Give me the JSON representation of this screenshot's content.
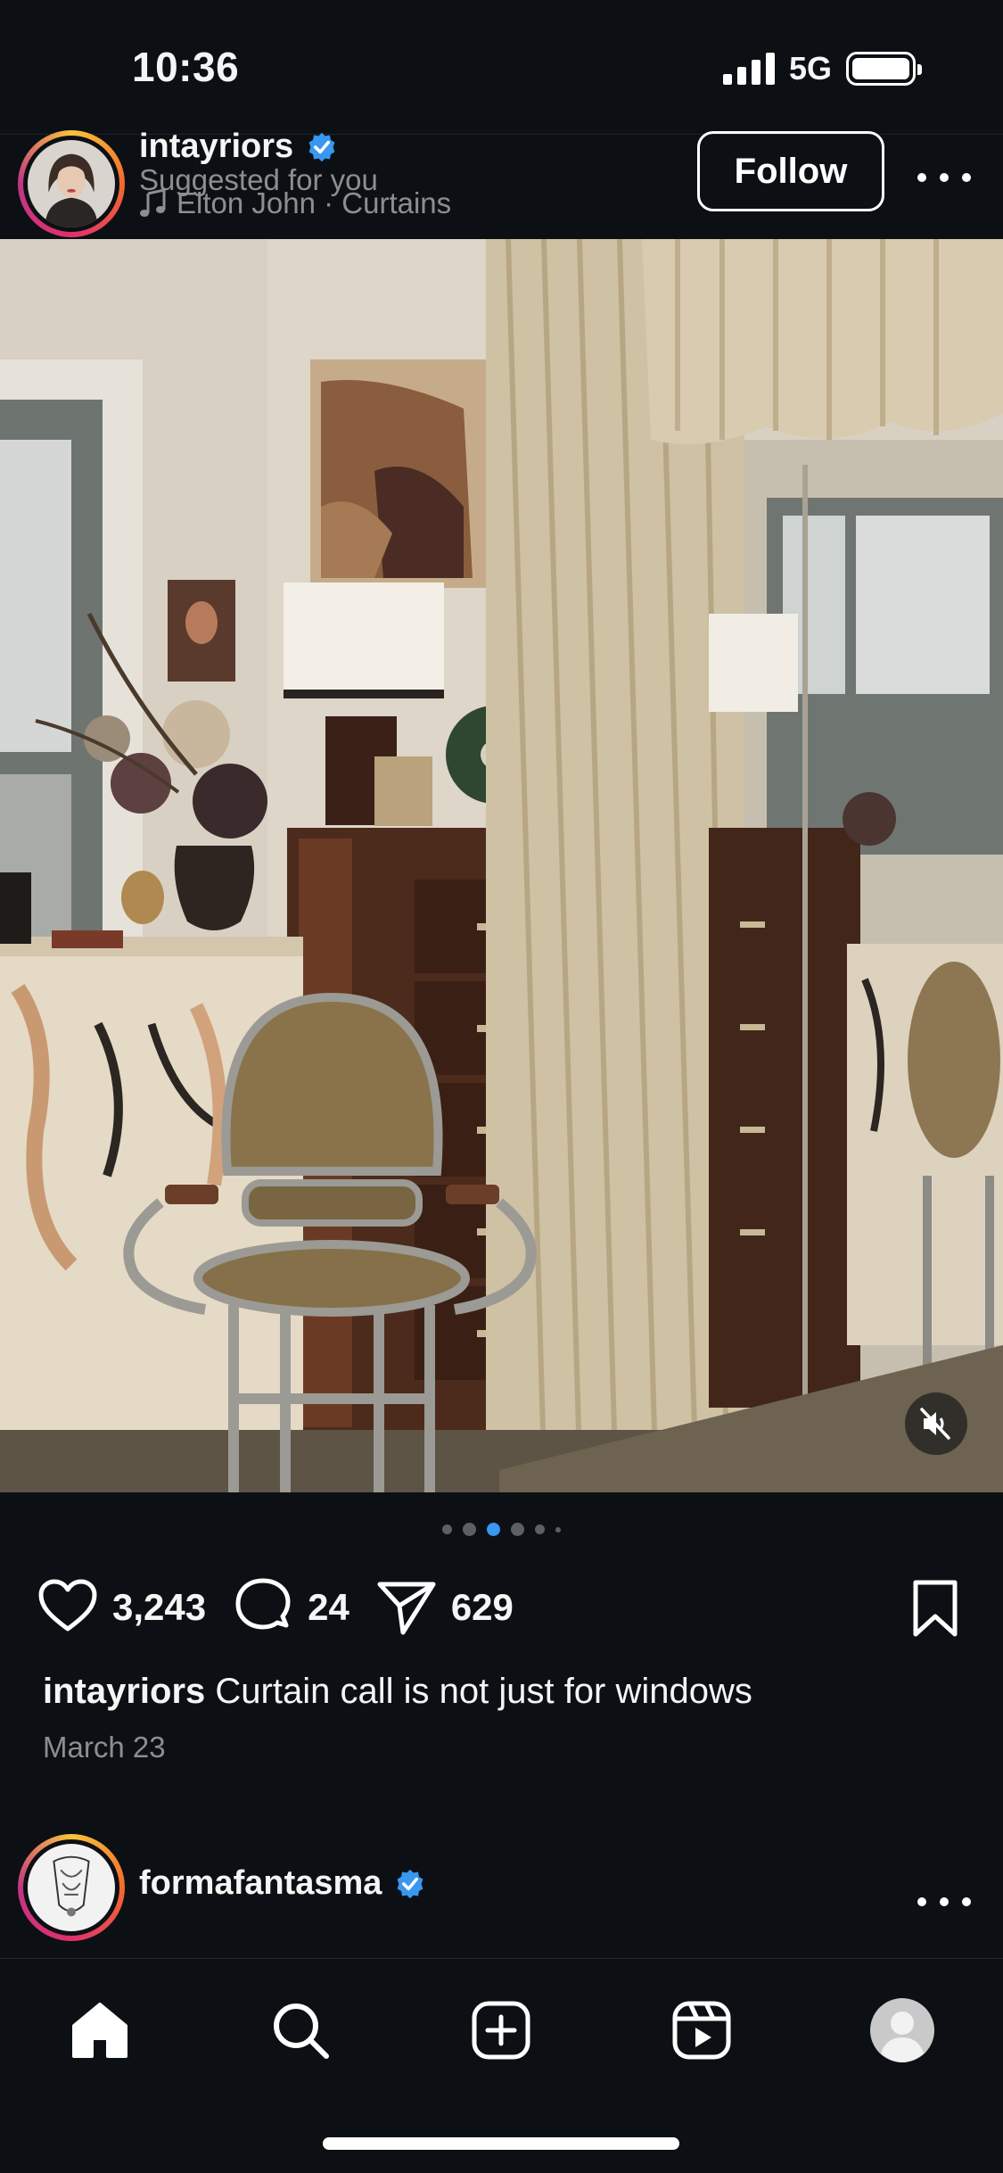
{
  "status_bar": {
    "time": "10:36",
    "network": "5G"
  },
  "post": {
    "username": "intayriors",
    "suggested": "Suggested for you",
    "music": "Elton John · Curtains",
    "follow_label": "Follow",
    "likes": "3,243",
    "comments": "24",
    "shares": "629",
    "caption_user": "intayriors",
    "caption_text": "Curtain call is not just for windows",
    "date": "March 23",
    "carousel": {
      "count": 6,
      "active_index": 2
    }
  },
  "next_post": {
    "username": "formafantasma"
  },
  "icons": {
    "like": "heart-icon",
    "comment": "comment-icon",
    "share": "send-icon",
    "save": "bookmark-icon",
    "mute": "muted-speaker-icon",
    "verified": "verified-badge-icon",
    "tabs": [
      "home-icon",
      "search-icon",
      "create-icon",
      "reels-icon",
      "profile-icon"
    ]
  },
  "colors": {
    "background": "#0c1014",
    "verified": "#3897f0",
    "active_dot": "#3897f0"
  }
}
